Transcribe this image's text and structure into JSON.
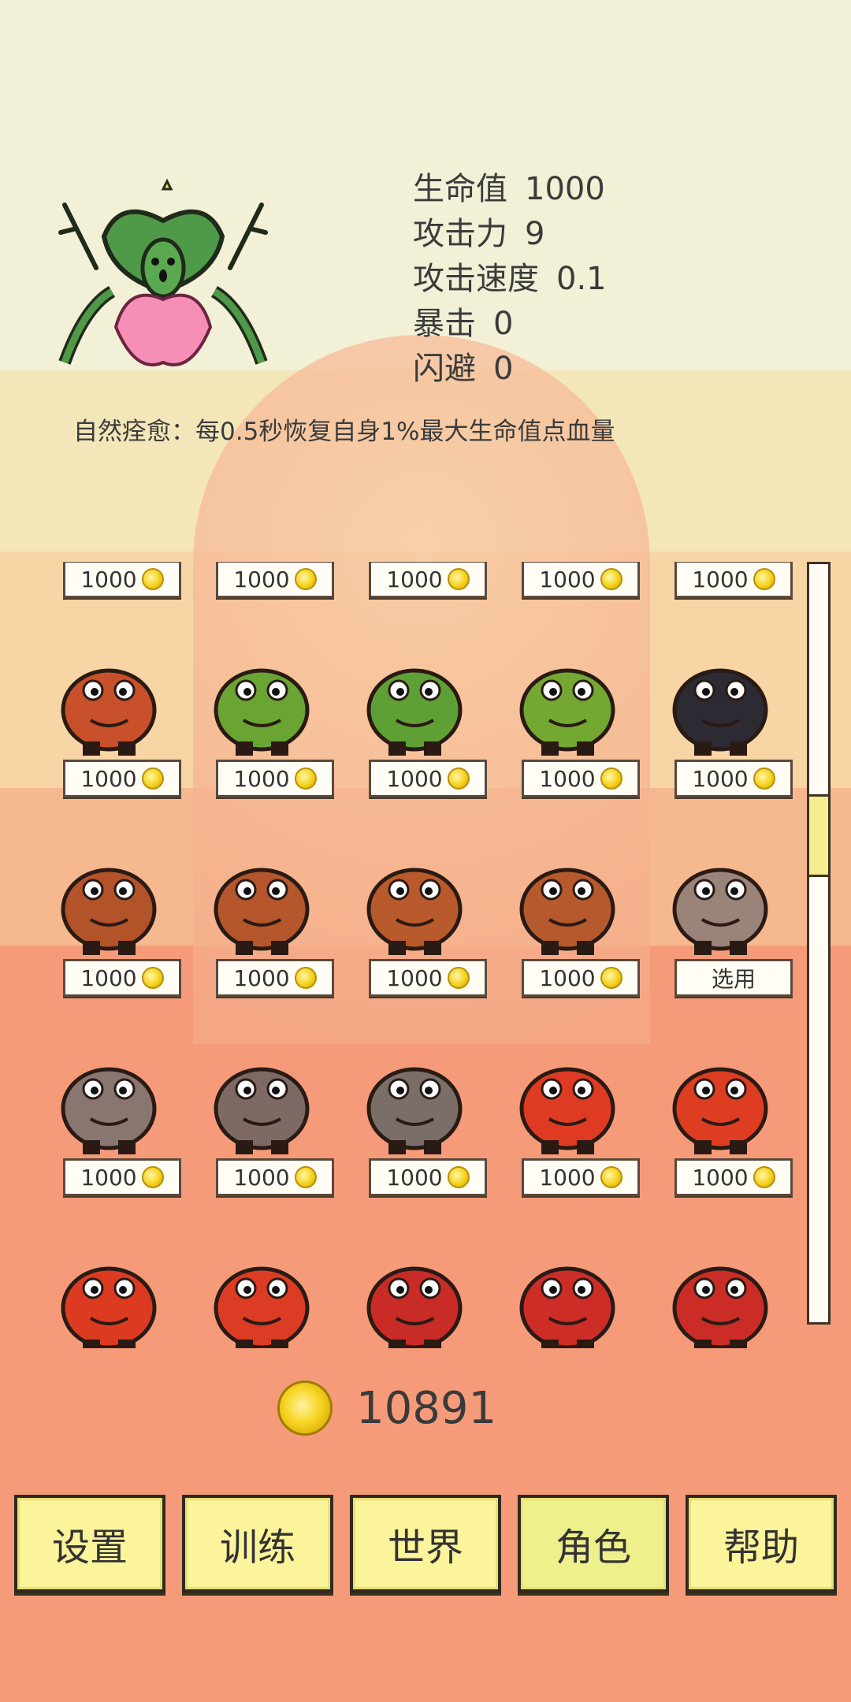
{
  "hero": {
    "name_icon": "plant-monster-sprite",
    "stats": [
      {
        "label": "生命值",
        "value": "1000"
      },
      {
        "label": "攻击力",
        "value": "9"
      },
      {
        "label": "攻击速度",
        "value": "0.1"
      },
      {
        "label": "暴击",
        "value": "0"
      },
      {
        "label": "闪避",
        "value": "0"
      }
    ],
    "skill": "自然痊愈：每0.5秒恢复自身1%最大生命值点血量"
  },
  "characters": {
    "rows": [
      [
        {
          "sprite": "partial-top-sprite",
          "price": "1000"
        },
        {
          "sprite": "partial-top-sprite",
          "price": "1000"
        },
        {
          "sprite": "partial-top-sprite",
          "price": "1000"
        },
        {
          "sprite": "partial-top-sprite",
          "price": "1000"
        },
        {
          "sprite": "partial-top-sprite",
          "price": "1000"
        }
      ],
      [
        {
          "sprite": "bandana-lizard-sprite",
          "price": "1000",
          "color": "#c8502a"
        },
        {
          "sprite": "green-goblin-sprite",
          "price": "1000",
          "color": "#6aa534"
        },
        {
          "sprite": "green-ogre-sprite",
          "price": "1000",
          "color": "#5fa036"
        },
        {
          "sprite": "goblin-spearman-sprite",
          "price": "1000",
          "color": "#74a832"
        },
        {
          "sprite": "black-ninja-sprite",
          "price": "1000",
          "color": "#2c2a33"
        }
      ],
      [
        {
          "sprite": "brown-bull-sprite",
          "price": "1000",
          "color": "#b2532a"
        },
        {
          "sprite": "ring-bull-sprite",
          "price": "1000",
          "color": "#b5562c"
        },
        {
          "sprite": "bull-warrior-sprite",
          "price": "1000",
          "color": "#b95a2c"
        },
        {
          "sprite": "horned-bull-sprite",
          "price": "1000",
          "color": "#b65a2e"
        },
        {
          "sprite": "stone-ape-sprite",
          "select": "选用",
          "color": "#9a8378"
        }
      ],
      [
        {
          "sprite": "rock-golem-sprite",
          "price": "1000",
          "color": "#8a7670"
        },
        {
          "sprite": "block-golem-sprite",
          "price": "1000",
          "color": "#7d6a65"
        },
        {
          "sprite": "sword-rock-sprite",
          "price": "1000",
          "color": "#7b6e68"
        },
        {
          "sprite": "red-croc-sprite",
          "price": "1000",
          "color": "#df3b23"
        },
        {
          "sprite": "red-mustache-croc-sprite",
          "price": "1000",
          "color": "#df3d22"
        }
      ],
      [
        {
          "sprite": "red-croc-small-sprite",
          "color": "#dd3a22"
        },
        {
          "sprite": "red-croc-grin-sprite",
          "color": "#dc3c24"
        },
        {
          "sprite": "red-devil-sprite",
          "color": "#c92b27"
        },
        {
          "sprite": "red-devil-smile-sprite",
          "color": "#cd2d27"
        },
        {
          "sprite": "red-devil-horn-sprite",
          "color": "#cb2d26"
        }
      ]
    ]
  },
  "wallet": {
    "coins": "10891"
  },
  "nav": [
    {
      "label": "设置",
      "active": false
    },
    {
      "label": "训练",
      "active": false
    },
    {
      "label": "世界",
      "active": false
    },
    {
      "label": "角色",
      "active": true
    },
    {
      "label": "帮助",
      "active": false
    }
  ]
}
